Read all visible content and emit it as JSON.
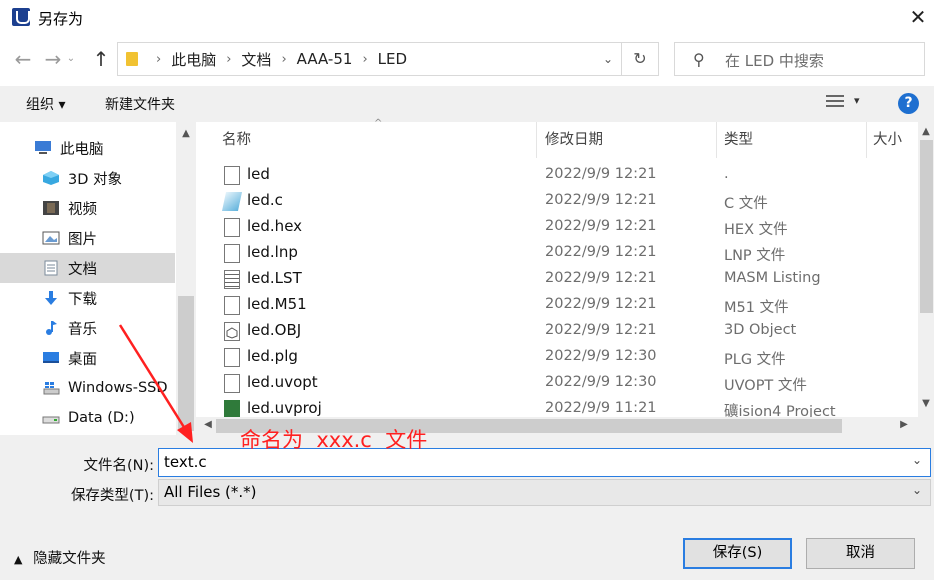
{
  "window": {
    "title": "另存为",
    "close_glyph": "✕"
  },
  "nav_buttons": {
    "back": "←",
    "forward": "→",
    "up": "↑"
  },
  "address": {
    "crumbs": [
      "此电脑",
      "文档",
      "AAA-51",
      "LED"
    ],
    "refresh": "↻"
  },
  "search": {
    "placeholder": "在 LED 中搜索"
  },
  "toolbar": {
    "organize": "组织 ▾",
    "new_folder": "新建文件夹",
    "help": "?"
  },
  "sidebar": {
    "items": [
      {
        "label": "此电脑",
        "icon": "computer-icon",
        "color": "#3a7bd5"
      },
      {
        "label": "3D 对象",
        "icon": "cube-icon",
        "color": "#38a8e0"
      },
      {
        "label": "视频",
        "icon": "film-icon",
        "color": "#444444"
      },
      {
        "label": "图片",
        "icon": "picture-icon",
        "color": "#6a9bd1"
      },
      {
        "label": "文档",
        "icon": "document-icon",
        "color": "#7a8a9a",
        "selected": true
      },
      {
        "label": "下载",
        "icon": "download-arrow-icon",
        "color": "#2a7de1"
      },
      {
        "label": "音乐",
        "icon": "music-note-icon",
        "color": "#2a7de1"
      },
      {
        "label": "桌面",
        "icon": "desktop-icon",
        "color": "#2a7de1"
      },
      {
        "label": "Windows-SSD",
        "icon": "windows-drive-icon",
        "color": "#2a7de1"
      },
      {
        "label": "Data (D:)",
        "icon": "drive-icon",
        "color": "#777777"
      }
    ]
  },
  "columns": [
    "名称",
    "修改日期",
    "类型",
    "大小"
  ],
  "files": [
    {
      "name": "led",
      "date": "2022/9/9 12:21",
      "type": ".",
      "icon": "blank-file-icon"
    },
    {
      "name": "led.c",
      "date": "2022/9/9 12:21",
      "type": "C 文件",
      "icon": "c-source-file-icon"
    },
    {
      "name": "led.hex",
      "date": "2022/9/9 12:21",
      "type": "HEX 文件",
      "icon": "blank-file-icon"
    },
    {
      "name": "led.lnp",
      "date": "2022/9/9 12:21",
      "type": "LNP 文件",
      "icon": "blank-file-icon"
    },
    {
      "name": "led.LST",
      "date": "2022/9/9 12:21",
      "type": "MASM Listing",
      "icon": "text-file-icon"
    },
    {
      "name": "led.M51",
      "date": "2022/9/9 12:21",
      "type": "M51 文件",
      "icon": "blank-file-icon"
    },
    {
      "name": "led.OBJ",
      "date": "2022/9/9 12:21",
      "type": "3D Object",
      "icon": "3d-object-file-icon"
    },
    {
      "name": "led.plg",
      "date": "2022/9/9 12:30",
      "type": "PLG 文件",
      "icon": "blank-file-icon"
    },
    {
      "name": "led.uvopt",
      "date": "2022/9/9 12:30",
      "type": "UVOPT 文件",
      "icon": "blank-file-icon"
    },
    {
      "name": "led.uvproj",
      "date": "2022/9/9 11:21",
      "type": "礦ision4 Project",
      "icon": "uvision-project-icon"
    }
  ],
  "form": {
    "filename_label": "文件名(N):",
    "filename_value": "text.c",
    "type_label": "保存类型(T):",
    "type_value": "All Files (*.*)"
  },
  "annotation": {
    "text": "命名为  xxx.c  文件",
    "color": "#ff2020"
  },
  "footer": {
    "hide_folders": "隐藏文件夹",
    "save": "保存(S)",
    "cancel": "取消"
  },
  "colors": {
    "accent": "#2a7de1",
    "selection": "#d9d9d9",
    "panel": "#f0f0f0"
  }
}
